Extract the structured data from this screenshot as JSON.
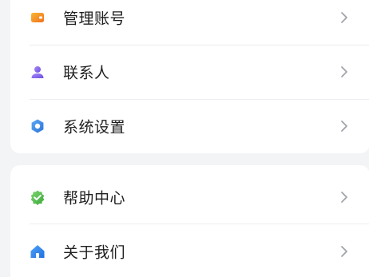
{
  "menu_group_1": {
    "items": [
      {
        "label": "管理账号",
        "icon": "wallet-icon",
        "color": "#f28a1c"
      },
      {
        "label": "联系人",
        "icon": "person-icon",
        "color": "#8e6cf0"
      },
      {
        "label": "系统设置",
        "icon": "gear-icon",
        "color": "#3a8ee6"
      }
    ]
  },
  "menu_group_2": {
    "items": [
      {
        "label": "帮助中心",
        "icon": "shield-check-icon",
        "color": "#4cb74a"
      },
      {
        "label": "关于我们",
        "icon": "home-icon",
        "color": "#2b7de9"
      }
    ]
  },
  "colors": {
    "background": "#f3f4f6",
    "card": "#ffffff",
    "text": "#1f1f1f",
    "chevron": "#a0a4aa",
    "divider": "#eceef1"
  }
}
